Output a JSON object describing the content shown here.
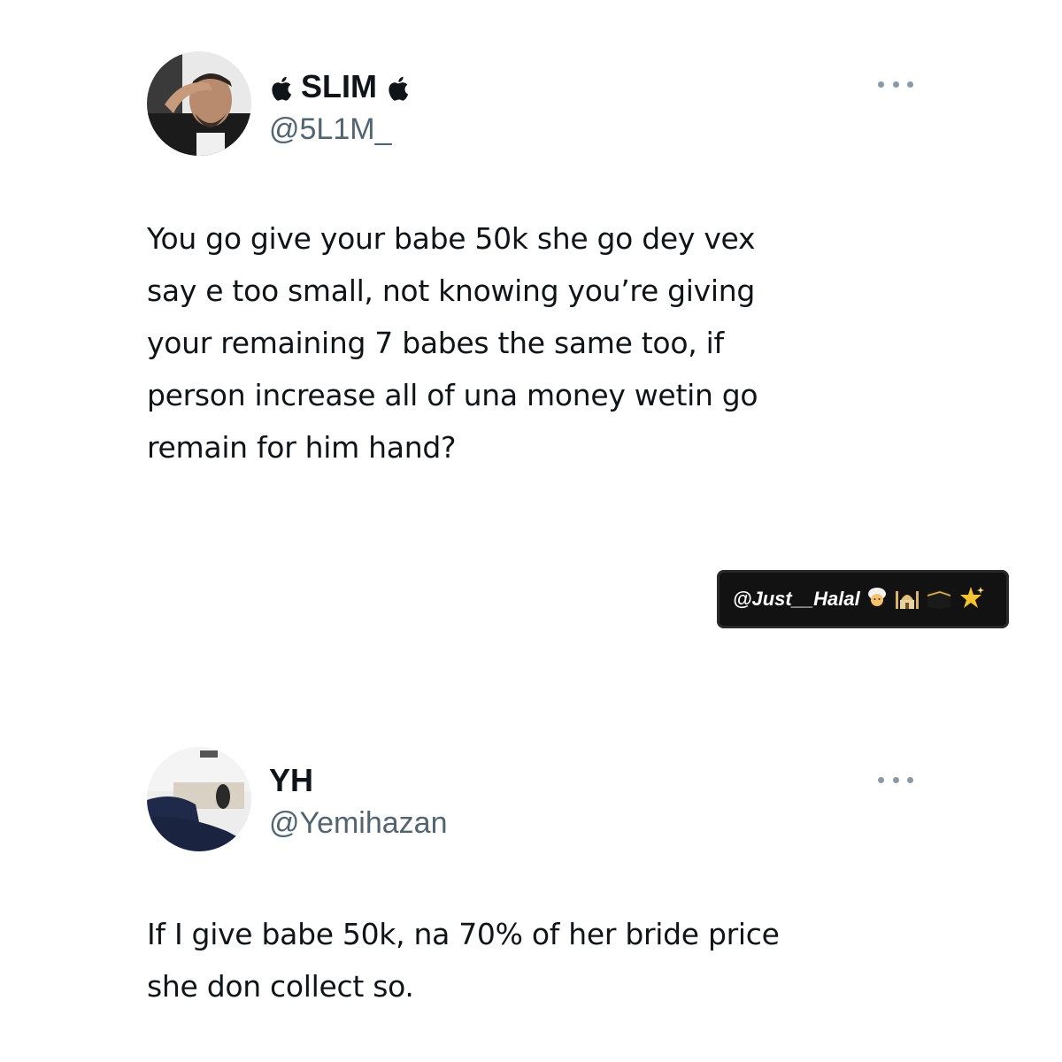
{
  "tweets": [
    {
      "display_name": "SLIM",
      "handle": "@5L1M_",
      "text_lines": [
        "You go give your babe 50k she go dey vex",
        "say e too small, not knowing you’re giving",
        "your remaining 7 babes the same too, if",
        "person increase all of una money wetin go",
        "remain for him hand?"
      ],
      "name_icons": [
        "apple-icon",
        "apple-icon"
      ]
    },
    {
      "display_name": "YH",
      "handle": "@Yemihazan",
      "text_lines": [
        "If I give babe 50k, na 70% of her bride price",
        "she don collect so."
      ]
    }
  ],
  "watermark": {
    "text": "@Just__Halal",
    "icons": [
      "person-with-turban-icon",
      "mosque-icon",
      "kaaba-icon",
      "sparkle-star-icon"
    ]
  },
  "colors": {
    "text": "#0f1419",
    "secondary_text": "#536471",
    "more_dots": "#8b98a5",
    "watermark_bg": "#121212"
  }
}
